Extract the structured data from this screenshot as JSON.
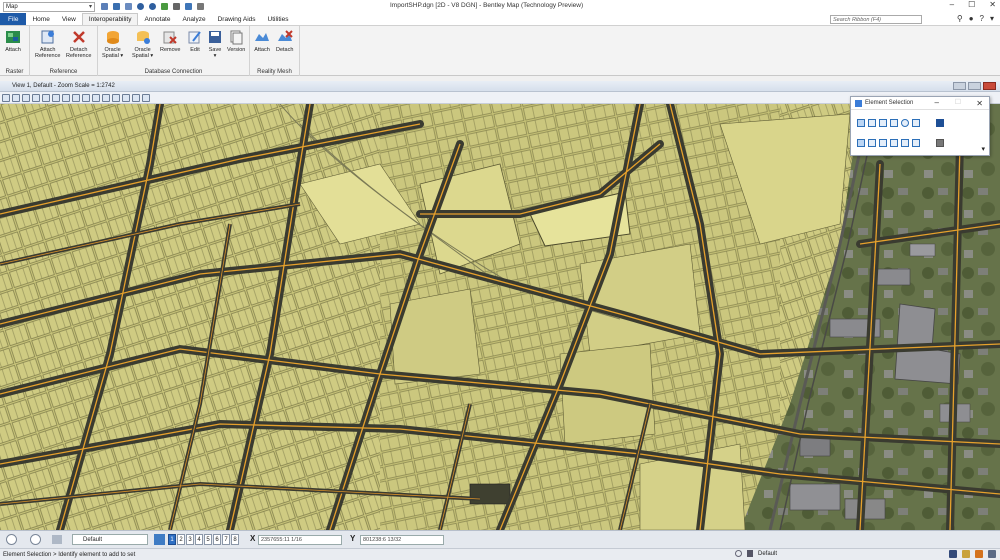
{
  "titlebar": {
    "workspace": "Map",
    "title": "ImportSHP.dgn [2D - V8 DGN] - Bentley Map (Technology Preview)"
  },
  "tabs": [
    "File",
    "Home",
    "View",
    "Interoperability",
    "Annotate",
    "Analyze",
    "Drawing Aids",
    "Utilities"
  ],
  "active_tab": "Interoperability",
  "search": {
    "placeholder": "Search Ribbon (F4)"
  },
  "ribbon": {
    "raster": {
      "label": "Raster",
      "attach": "Attach"
    },
    "reference": {
      "label": "Reference",
      "attach_line1": "Attach",
      "attach_line2": "Reference",
      "detach_line1": "Detach",
      "detach_line2": "Reference"
    },
    "database": {
      "label": "Database Connection",
      "oracle1_line1": "Oracle",
      "oracle1_line2": "Spatial ▾",
      "oracle2_line1": "Oracle",
      "oracle2_line2": "Spatial ▾",
      "remove": "Remove",
      "edit": "Edit",
      "save": "Save",
      "version": "Version"
    },
    "reality": {
      "label": "Reality Mesh",
      "attach": "Attach",
      "detach": "Detach"
    }
  },
  "view": {
    "title": "View 1, Default - Zoom Scale = 1:2742"
  },
  "element_selection": {
    "title": "Element Selection"
  },
  "bottom": {
    "level": "Default",
    "view_numbers": [
      "1",
      "2",
      "3",
      "4",
      "5",
      "6",
      "7",
      "8"
    ],
    "x_label": "X",
    "x_value": "2357655:11 1/16",
    "y_label": "Y",
    "y_value": "801238:6 13/32"
  },
  "status": {
    "message": "Element Selection > Identify element to add to set",
    "right_level": "Default"
  }
}
